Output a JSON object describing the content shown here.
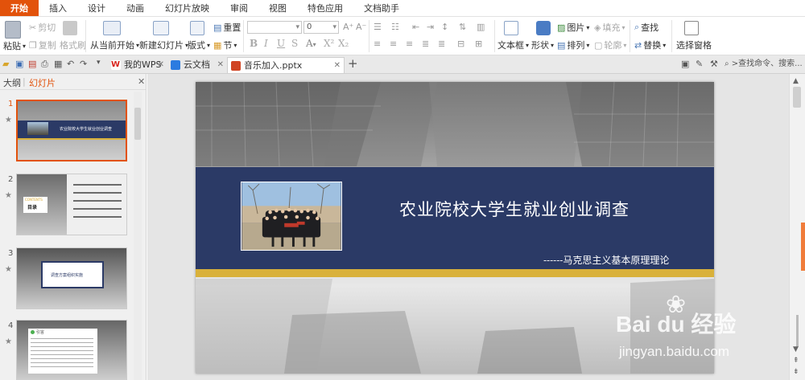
{
  "menu": {
    "tabs": [
      "开始",
      "插入",
      "设计",
      "动画",
      "幻灯片放映",
      "审阅",
      "视图",
      "特色应用",
      "文档助手"
    ],
    "active_index": 0
  },
  "ribbon": {
    "paste": "粘贴",
    "cut": "剪切",
    "copy": "复制",
    "format_painter": "格式刷",
    "from_current": "从当前开始",
    "new_slide": "新建幻灯片",
    "layout": "版式",
    "reset": "重置",
    "section": "节",
    "font_size": "0",
    "textbox": "文本框",
    "shape": "形状",
    "picture": "图片",
    "fill": "填充",
    "arrange": "排列",
    "outline": "轮廓",
    "find": "查找",
    "replace": "替换",
    "select_pane": "选择窗格"
  },
  "tabbar": {
    "tabs": [
      {
        "label": "我的WPS",
        "icon_color": "#d8251d"
      },
      {
        "label": "云文档",
        "icon_color": "#2b7be0"
      },
      {
        "label": "音乐加入.pptx",
        "icon_color": "#d04423"
      }
    ],
    "add": "+",
    "search_placeholder": ">查找命令、搜索..."
  },
  "panel": {
    "tab_outline": "大纲",
    "tab_slides": "幻灯片",
    "slide_numbers": [
      "1",
      "2",
      "3",
      "4"
    ],
    "thumb1_title": "农业院校大学生就业创业调查",
    "thumb2_title": "CONTENTS",
    "thumb2_heading": "目录",
    "thumb3_title": "调查方案组织实施",
    "thumb4_title": "引言"
  },
  "slide": {
    "title": "农业院校大学生就业创业调查",
    "subtitle": "------马克思主义基本原理理论"
  },
  "watermark": {
    "logo": "Bai du 经验",
    "url": "jingyan.baidu.com"
  },
  "colors": {
    "accent": "#e2520b",
    "banner": "#2b3a66",
    "gold": "#d9b13b"
  }
}
